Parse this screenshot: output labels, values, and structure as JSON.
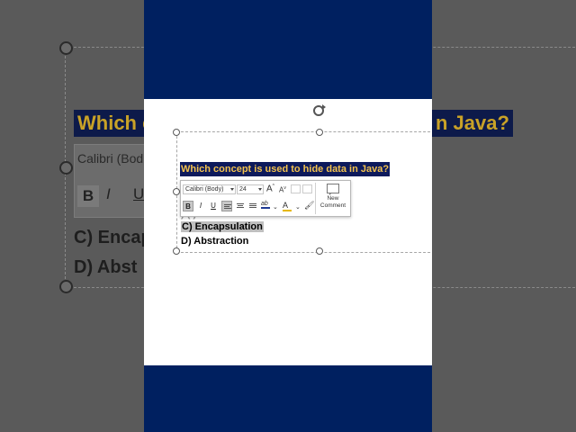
{
  "slide": {
    "question": "Which concept is used to hide data in Java?",
    "option_c": "C) Encapsulation",
    "option_d": "D) Abstraction",
    "option_b_fragment": ") ( ) "
  },
  "background": {
    "question_left": "Which c",
    "question_right": "n Java?",
    "font_fragment": "Calibri (Bod",
    "bold": "B",
    "italic": "I",
    "underline": "U",
    "option_c_fragment": "C) Encap",
    "option_d_fragment": "D) Abst"
  },
  "mini_toolbar": {
    "font_name": "Calibri (Body)",
    "font_size": "24",
    "grow_font": "A",
    "shrink_font": "A",
    "bold": "B",
    "italic": "I",
    "underline": "U",
    "new_comment_line1": "New",
    "new_comment_line2": "Comment"
  },
  "colors": {
    "video_bg": "#002060",
    "question_bg": "#0d1a5c",
    "question_text": "#f2c14e",
    "highlight": "#bfbfbf"
  }
}
